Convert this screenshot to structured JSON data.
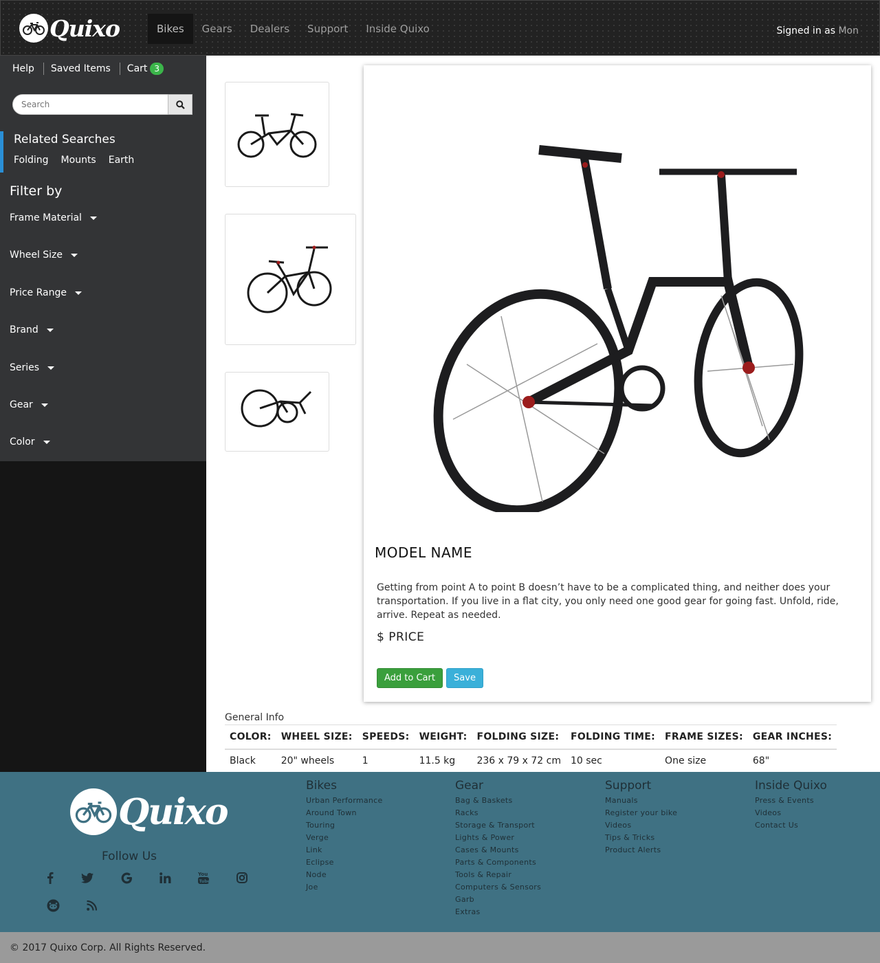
{
  "nav": {
    "brand": "Quixo",
    "links": [
      {
        "label": "Bikes",
        "active": true
      },
      {
        "label": "Gears"
      },
      {
        "label": "Dealers"
      },
      {
        "label": "Support"
      },
      {
        "label": "Inside Quixo"
      }
    ],
    "signed_in_prefix": "Signed in as",
    "user": "Mon"
  },
  "sidebar": {
    "top_links": {
      "help": "Help",
      "saved": "Saved Items",
      "cart": "Cart",
      "cart_count": "3"
    },
    "search": {
      "placeholder": "Search"
    },
    "related": {
      "title": "Related Searches",
      "links": [
        "Folding",
        "Mounts",
        "Earth"
      ]
    },
    "filter_title": "Filter by",
    "filters": [
      "Frame Material",
      "Wheel Size",
      "Price Range",
      "Brand",
      "Series",
      "Gear",
      "Color"
    ]
  },
  "product": {
    "model_name": "MODEL NAME",
    "description": "Getting from point A to point B doesn’t have to be a complicated thing, and neither does your transportation. If you live in a flat city, you only need one good gear for going fast. Unfold, ride, arrive. Repeat as needed.",
    "price": "$ PRICE",
    "add_to_cart": "Add to Cart",
    "save": "Save"
  },
  "specs": {
    "title": "General Info",
    "headers": [
      "COLOR:",
      "WHEEL SIZE:",
      "SPEEDS:",
      "WEIGHT:",
      "FOLDING SIZE:",
      "FOLDING TIME:",
      "FRAME SIZES:",
      "GEAR INCHES:"
    ],
    "values": [
      "Black",
      "20\" wheels",
      "1",
      "11.5 kg",
      "236 x 79 x 72 cm",
      "10 sec",
      "One size",
      "68\""
    ]
  },
  "footer": {
    "brand": "Quixo",
    "follow": "Follow Us",
    "columns": [
      {
        "title": "Bikes",
        "links": [
          "Urban Performance",
          "Around Town",
          "Touring",
          "Verge",
          "Link",
          "Eclipse",
          "Node",
          "Joe"
        ]
      },
      {
        "title": "Gear",
        "links": [
          "Bag & Baskets",
          "Racks",
          "Storage & Transport",
          "Lights & Power",
          "Cases & Mounts",
          "Parts & Components",
          "Tools & Repair",
          "Computers & Sensors",
          "Garb",
          "Extras"
        ]
      },
      {
        "title": "Support",
        "links": [
          "Manuals",
          "Register your bike",
          "Videos",
          "Tips & Tricks",
          "Product Alerts"
        ]
      },
      {
        "title": "Inside Quixo",
        "links": [
          "Press & Events",
          "Videos",
          "Contact Us"
        ]
      }
    ],
    "copyright": "© 2017 Quixo Corp. All Rights Reserved."
  }
}
